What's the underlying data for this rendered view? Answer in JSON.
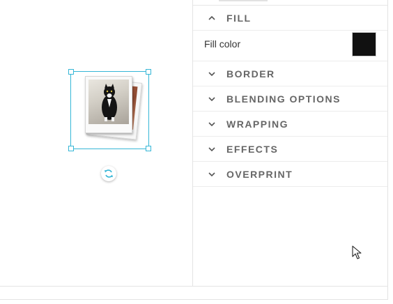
{
  "canvas": {
    "selected_object": "image-group",
    "rotate_icon": "rotate-icon"
  },
  "panel": {
    "sections": [
      {
        "id": "fill",
        "label": "FILL",
        "expanded": true,
        "icon": "chevron-up-icon"
      },
      {
        "id": "border",
        "label": "BORDER",
        "expanded": false,
        "icon": "chevron-down-icon"
      },
      {
        "id": "blending",
        "label": "BLENDING OPTIONS",
        "expanded": false,
        "icon": "chevron-down-icon"
      },
      {
        "id": "wrapping",
        "label": "WRAPPING",
        "expanded": false,
        "icon": "chevron-down-icon"
      },
      {
        "id": "effects",
        "label": "EFFECTS",
        "expanded": false,
        "icon": "chevron-down-icon"
      },
      {
        "id": "overprint",
        "label": "OVERPRINT",
        "expanded": false,
        "icon": "chevron-down-icon"
      }
    ],
    "fill": {
      "label": "Fill color",
      "color": "#111111"
    }
  },
  "colors": {
    "selection": "#35b6d6",
    "section_label": "#666666"
  }
}
